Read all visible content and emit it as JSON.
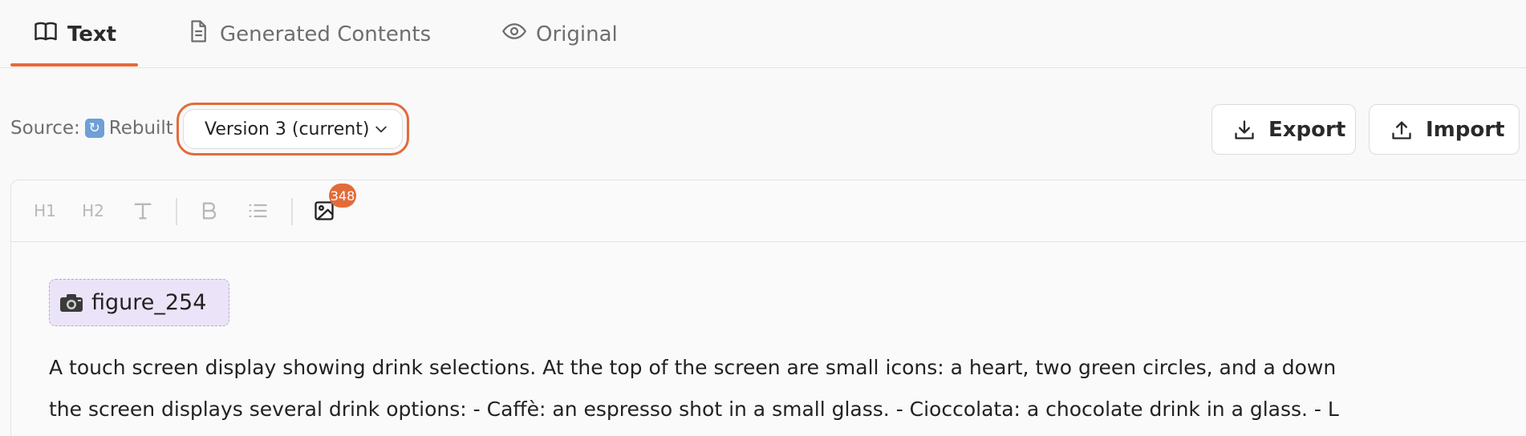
{
  "tabs": [
    {
      "label": "Text",
      "icon": "book-icon",
      "active": true
    },
    {
      "label": "Generated Contents",
      "icon": "document-icon",
      "active": false
    },
    {
      "label": "Original",
      "icon": "eye-icon",
      "active": false
    }
  ],
  "source": {
    "label": "Source:",
    "value": "Rebuilt",
    "icon": "rebuilt-icon"
  },
  "version_select": {
    "value": "Version 3 (current)"
  },
  "actions": {
    "export_label": "Export",
    "import_label": "Import"
  },
  "toolbar": {
    "h1": "H1",
    "h2": "H2",
    "image_badge": "348"
  },
  "editor": {
    "figure_label": "figure_254",
    "paragraph_lines": [
      "A touch screen display showing drink selections. At the top of the screen are small icons: a heart, two green circles, and a down",
      "the screen displays several drink options: - Caffè: an espresso shot in a small glass. - Cioccolata: a chocolate drink in a glass. - L"
    ]
  },
  "colors": {
    "accent": "#e36b3a",
    "chip_bg": "#ebe4f8",
    "chip_border": "#b7a3e0"
  }
}
